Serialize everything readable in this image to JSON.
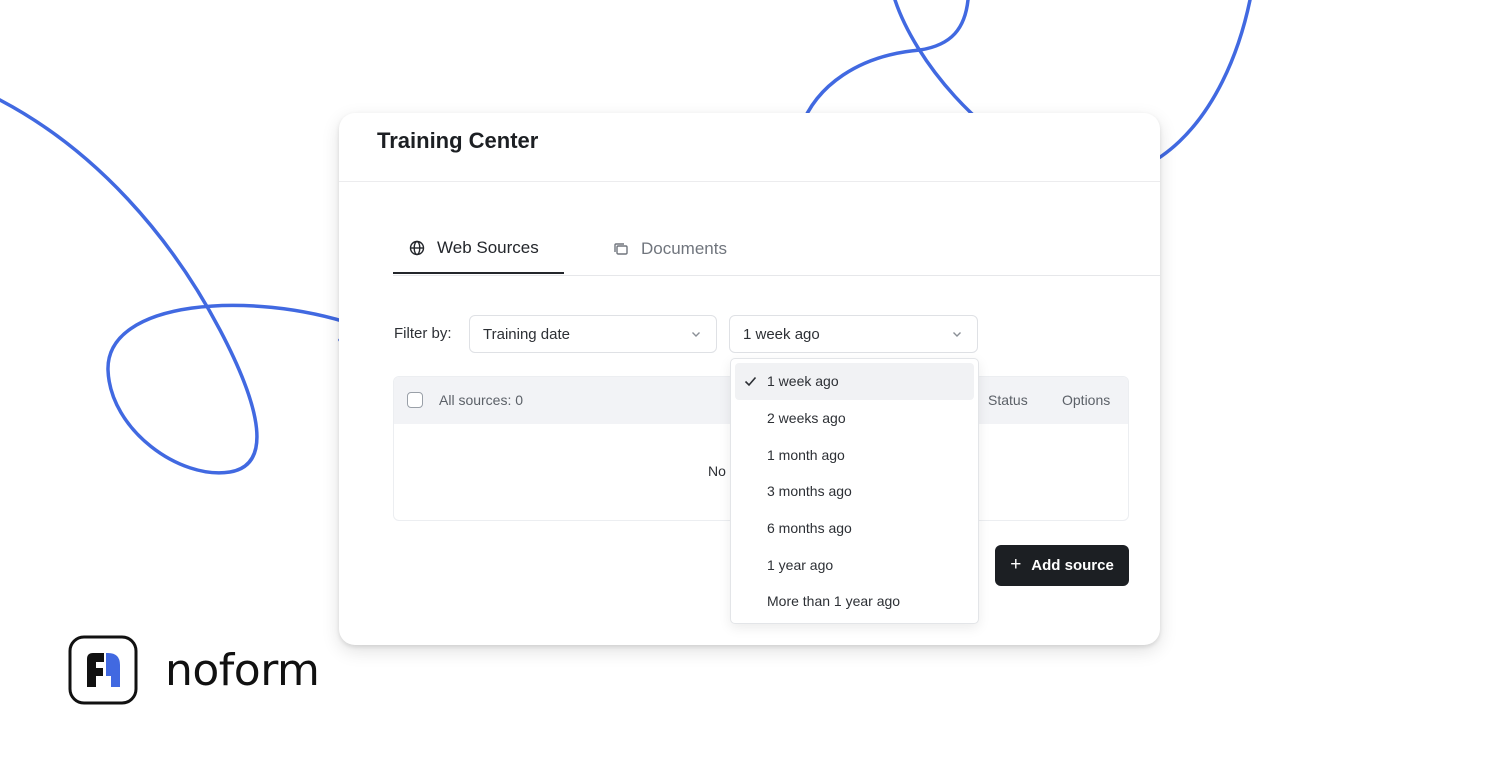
{
  "brand": {
    "name": "noform",
    "accent_color": "#4169e1"
  },
  "card": {
    "title": "Training Center"
  },
  "tabs": [
    {
      "label": "Web Sources",
      "icon": "globe-icon",
      "active": true
    },
    {
      "label": "Documents",
      "icon": "documents-icon",
      "active": false
    }
  ],
  "filter": {
    "label": "Filter by:",
    "field_value": "Training date",
    "period_value": "1 week ago"
  },
  "table": {
    "all_sources_label": "All sources: 0",
    "status_header": "Status",
    "options_header": "Options",
    "empty_text": "No"
  },
  "dropdown": {
    "options": [
      "1 week ago",
      "2 weeks ago",
      "1 month ago",
      "3 months ago",
      "6 months ago",
      "1 year ago",
      "More than 1 year ago"
    ],
    "selected": "1 week ago"
  },
  "actions": {
    "add_source_label": "Add source"
  }
}
